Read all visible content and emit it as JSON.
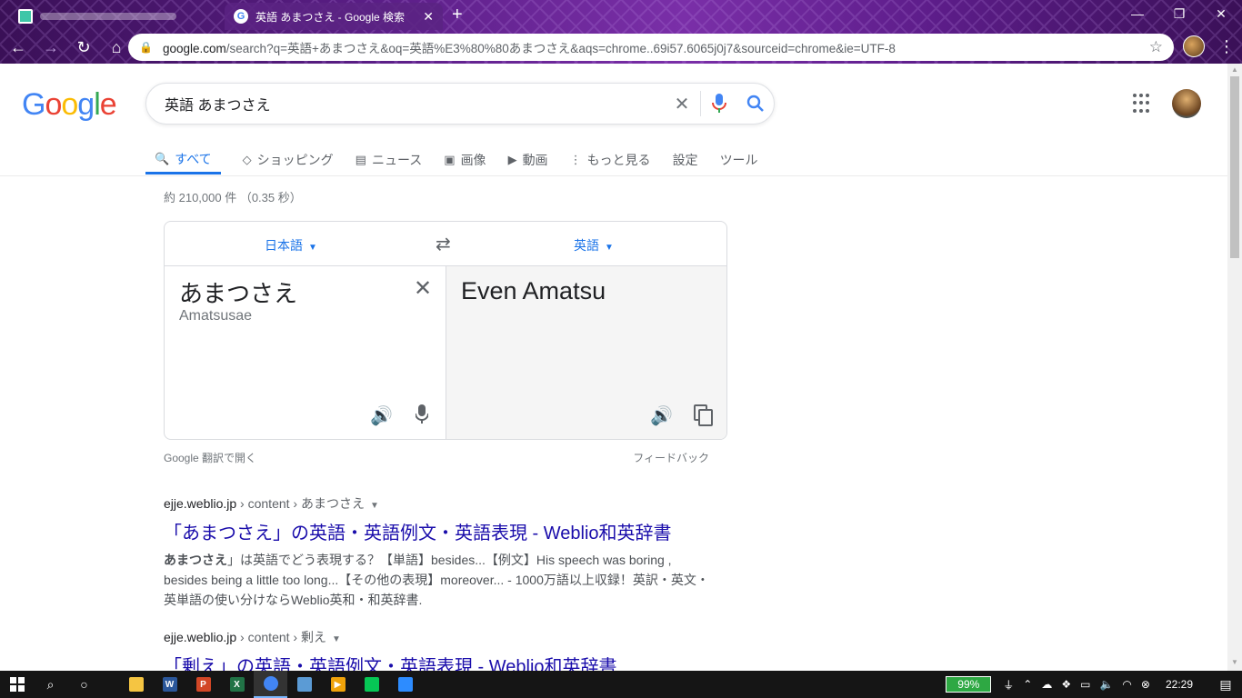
{
  "browser": {
    "inactive_tab_icon": "notes-app-icon",
    "active_tab_title": "英語 あまつさえ - Google 検索",
    "new_tab": "+",
    "window_controls": {
      "minimize": "—",
      "restore": "❐",
      "close": "✕"
    },
    "url_host": "google.com",
    "url_rest": "/search?q=英語+あまつさえ&oq=英語%E3%80%80あまつさえ&aqs=chrome..69i57.6065j0j7&sourceid=chrome&ie=UTF-8"
  },
  "google": {
    "logo": [
      "G",
      "o",
      "o",
      "g",
      "l",
      "e"
    ],
    "logo_colors": [
      "#4285f4",
      "#ea4335",
      "#fbbc05",
      "#4285f4",
      "#34a853",
      "#ea4335"
    ],
    "search_value": "英語 あまつさえ",
    "tabs": [
      {
        "icon": "search-icon",
        "glyph": "🔍",
        "label": "すべて"
      },
      {
        "icon": "tag-icon",
        "glyph": "◇",
        "label": "ショッピング"
      },
      {
        "icon": "news-icon",
        "glyph": "▤",
        "label": "ニュース"
      },
      {
        "icon": "image-icon",
        "glyph": "▣",
        "label": "画像"
      },
      {
        "icon": "video-icon",
        "glyph": "▶",
        "label": "動画"
      },
      {
        "icon": "more-icon",
        "glyph": "⋮",
        "label": "もっと見る"
      },
      {
        "icon": "",
        "glyph": "",
        "label": "設定"
      },
      {
        "icon": "",
        "glyph": "",
        "label": "ツール"
      }
    ],
    "stats": "約 210,000 件 （0.35 秒）"
  },
  "translate": {
    "source_lang": "日本語",
    "target_lang": "英語",
    "source_text": "あまつさえ",
    "romanization": "Amatsusae",
    "target_text": "Even Amatsu",
    "open_link": "Google 翻訳で開く",
    "feedback": "フィードバック"
  },
  "results": [
    {
      "host": "ejje.weblio.jp",
      "path": " › content › あまつさえ",
      "title": "「あまつさえ」の英語・英語例文・英語表現 - Weblio和英辞書",
      "snippet_bold": "あまつさえ",
      "snippet_line1": "」は英語でどう表現する？【単語】besides...【例文】His speech was boring ,",
      "snippet_line2": "besides being a little too long...【その他の表現】moreover... - 1000万語以上収録！英訳・英文・",
      "snippet_line3": "英単語の使い分けならWeblio英和・和英辞書."
    },
    {
      "host": "ejje.weblio.jp",
      "path": " › content › 剰え",
      "title": "「剰え」の英語・英語例文・英語表現 - Weblio和英辞書"
    }
  ],
  "taskbar": {
    "apps": [
      {
        "name": "file-explorer-icon",
        "label": "",
        "color": "#f5c542"
      },
      {
        "name": "word-icon",
        "label": "W",
        "color": "#2b579a"
      },
      {
        "name": "powerpoint-icon",
        "label": "P",
        "color": "#d24726"
      },
      {
        "name": "excel-icon",
        "label": "X",
        "color": "#217346"
      },
      {
        "name": "chrome-icon",
        "label": "",
        "color": "#4285f4"
      },
      {
        "name": "contacts-icon",
        "label": "",
        "color": "#5b9bd5"
      },
      {
        "name": "media-player-icon",
        "label": "▶",
        "color": "#f0a30a"
      },
      {
        "name": "line-icon",
        "label": "",
        "color": "#06c755"
      },
      {
        "name": "zoom-icon",
        "label": "",
        "color": "#2d8cff"
      }
    ],
    "battery": "99%",
    "clock": "22:29"
  }
}
